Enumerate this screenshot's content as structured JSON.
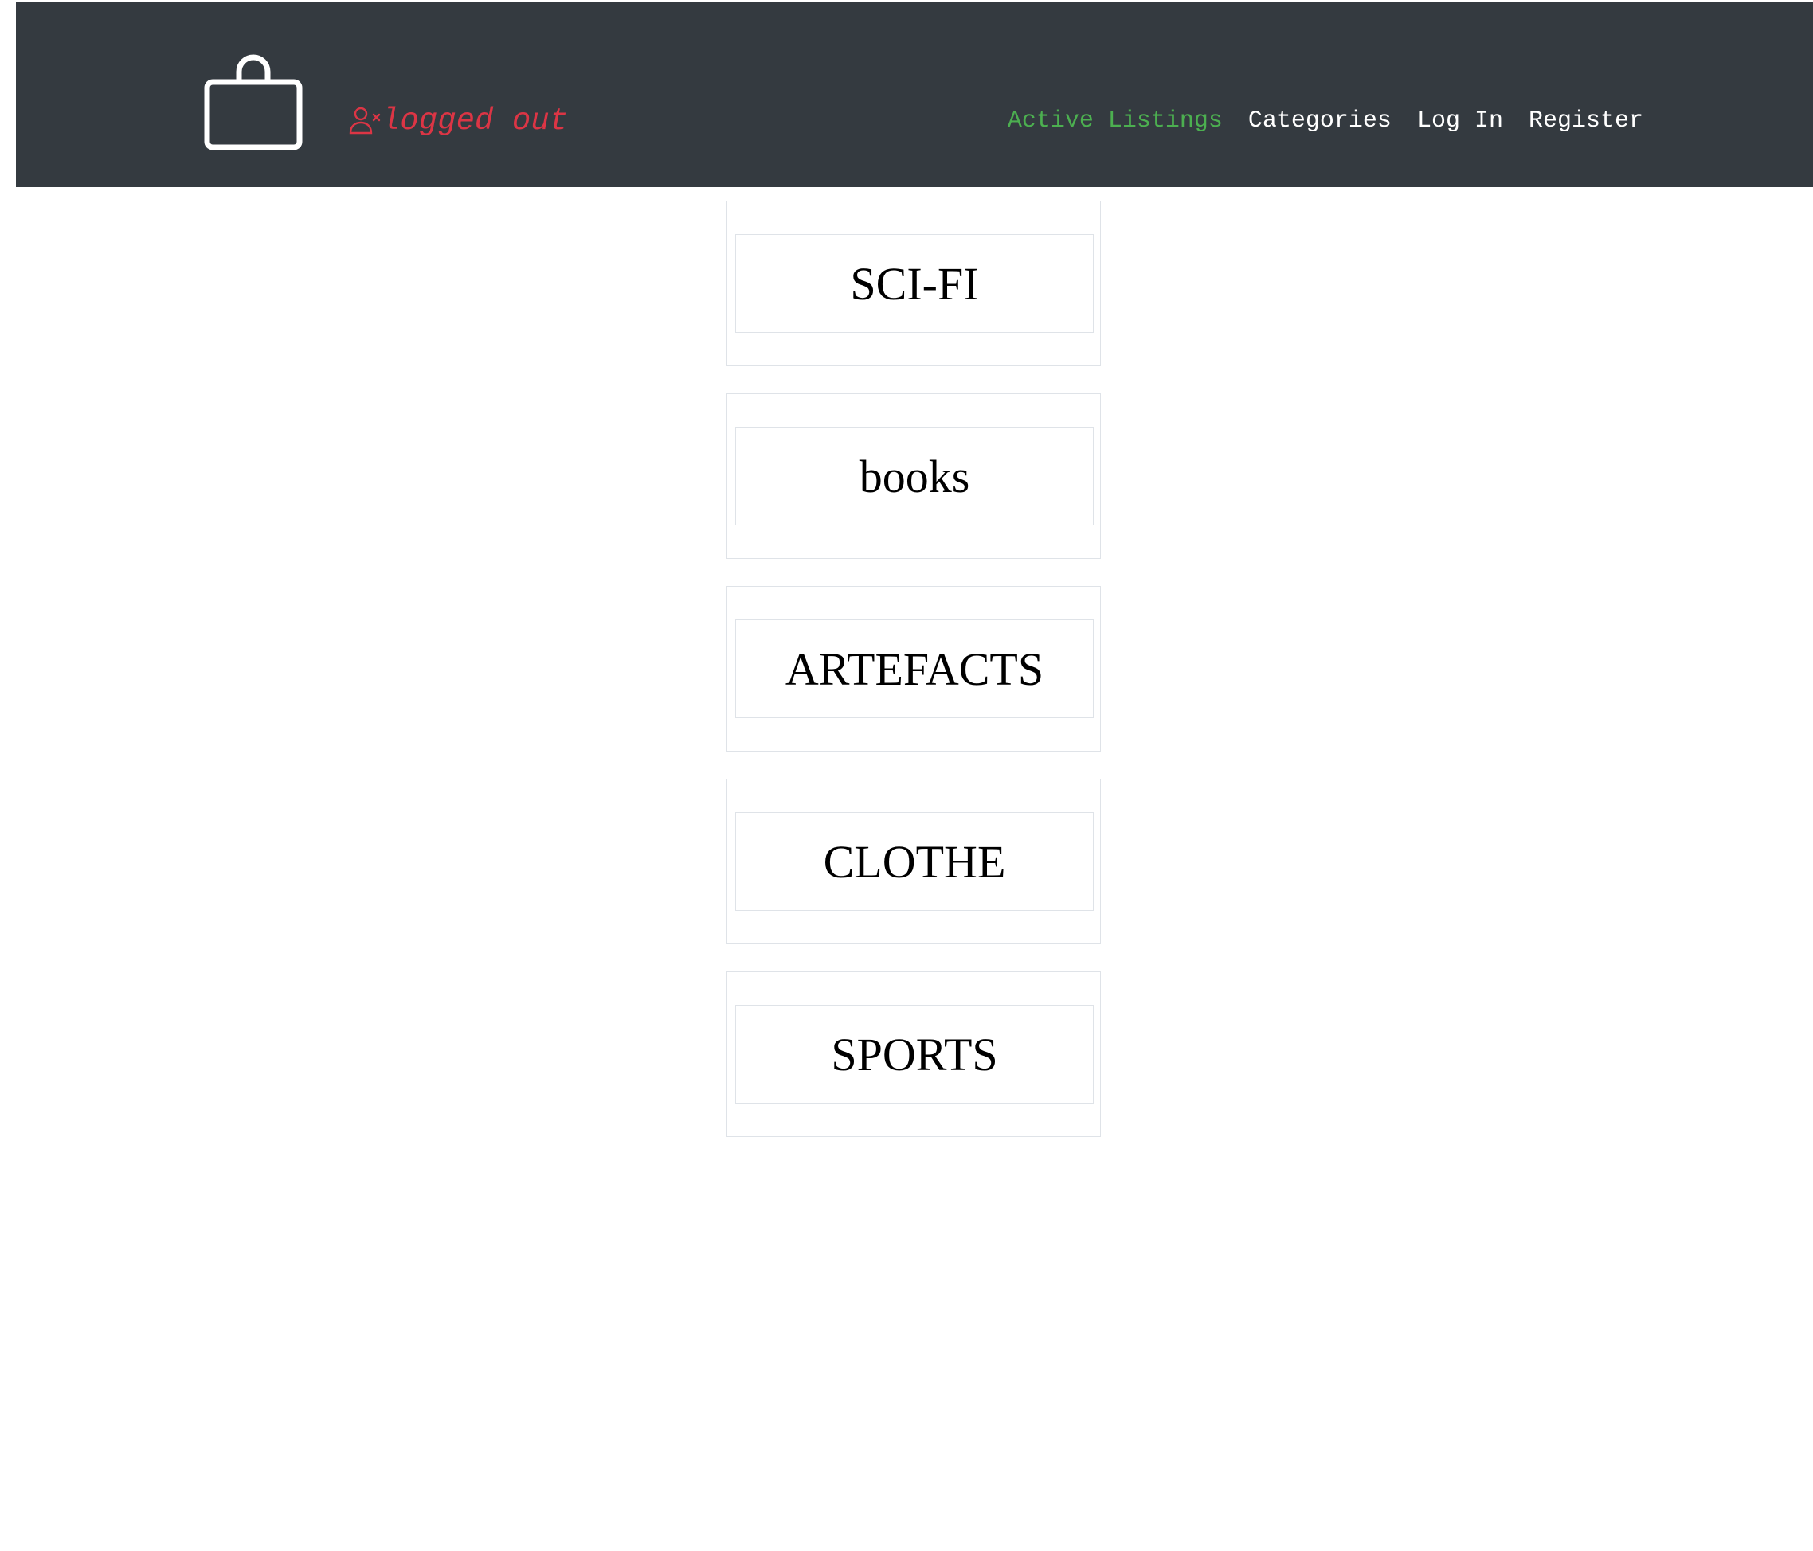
{
  "header": {
    "brand_icon": "shopping-bag-icon",
    "status": {
      "icon": "user-x-icon",
      "text": "logged out",
      "color": "#dc3545"
    },
    "nav": [
      {
        "label": "Active Listings",
        "active": true,
        "color": "#4caf50"
      },
      {
        "label": "Categories",
        "active": false
      },
      {
        "label": "Log In",
        "active": false
      },
      {
        "label": "Register",
        "active": false
      }
    ],
    "background": "#343a40"
  },
  "categories": [
    {
      "label": "SCI-FI"
    },
    {
      "label": "books"
    },
    {
      "label": "ARTEFACTS"
    },
    {
      "label": "CLOTHE"
    },
    {
      "label": "SPORTS"
    }
  ]
}
